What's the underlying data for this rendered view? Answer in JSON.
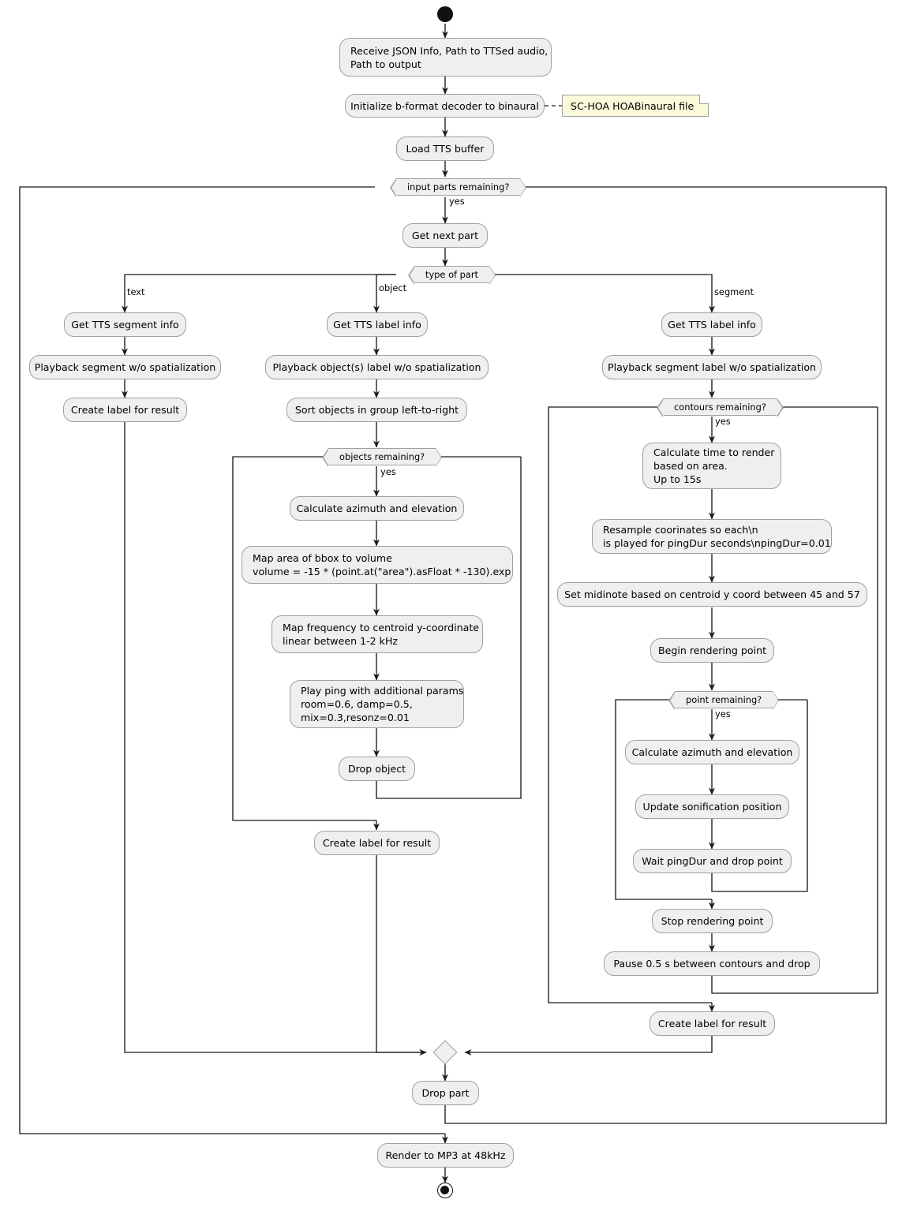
{
  "diagram": {
    "title": "Sonification rendering activity diagram",
    "type": "uml-activity",
    "colors": {
      "node_fill": "#EFEFEF",
      "node_border": "#A0A0A0",
      "note_fill": "#FBFBDB",
      "line": "#1A1A1A",
      "background": "#FFFFFF"
    }
  },
  "nodes": {
    "start": "",
    "receive_json": "Receive JSON Info, Path to TTSed audio,\nPath to output",
    "init_decoder": "Initialize b-format decoder to binaural",
    "note_hoa": "SC-HOA HOABinaural file",
    "load_tts": "Load TTS buffer",
    "input_parts_remaining": "input parts remaining?",
    "get_next_part": "Get next part",
    "type_of_part": "type of part",
    "text_get_tts_segment_info": "Get TTS segment info",
    "text_playback_segment": "Playback segment w/o spatialization",
    "text_create_label": "Create label for result",
    "object_get_tts_label_info": "Get TTS label info",
    "object_playback_label": "Playback object(s) label w/o spatialization",
    "object_sort": "Sort objects in group left-to-right",
    "objects_remaining": "objects remaining?",
    "object_calc_azimuth": "Calculate azimuth and elevation",
    "object_map_area": "Map area of bbox to volume\nvolume = -15 * (point.at(\"area\").asFloat * -130).exp",
    "object_map_freq": "Map frequency to centroid y-coordinate\nlinear between 1-2 kHz",
    "object_play_ping": "Play ping with additional params\nroom=0.6, damp=0.5,\nmix=0.3,resonz=0.01",
    "object_drop": "Drop object",
    "object_create_label": "Create label for result",
    "segment_get_tts_label_info": "Get TTS label info",
    "segment_playback_label": "Playback segment label w/o spatialization",
    "contours_remaining": "contours remaining?",
    "segment_calc_time": "Calculate time to render\nbased on area.\nUp to 15s",
    "segment_resample": "Resample coorinates so each\\n\nis played for pingDur seconds\\npingDur=0.01",
    "segment_set_midinote": "Set midinote based on centroid y coord between 45 and 57",
    "segment_begin_render": "Begin rendering point",
    "point_remaining": "point remaining?",
    "point_calc_azimuth": "Calculate azimuth and elevation",
    "point_update_position": "Update sonification position",
    "point_wait": "Wait pingDur and drop point",
    "segment_stop_render": "Stop rendering point",
    "segment_pause": "Pause 0.5 s between contours and drop",
    "segment_create_label": "Create label for result",
    "merge": "",
    "drop_part": "Drop part",
    "render_mp3": "Render to MP3 at 48kHz",
    "end": ""
  },
  "edge_labels": {
    "input_parts_yes": "yes",
    "branch_text": "text",
    "branch_object": "object",
    "branch_segment": "segment",
    "objects_yes": "yes",
    "contours_yes": "yes",
    "point_yes": "yes"
  }
}
